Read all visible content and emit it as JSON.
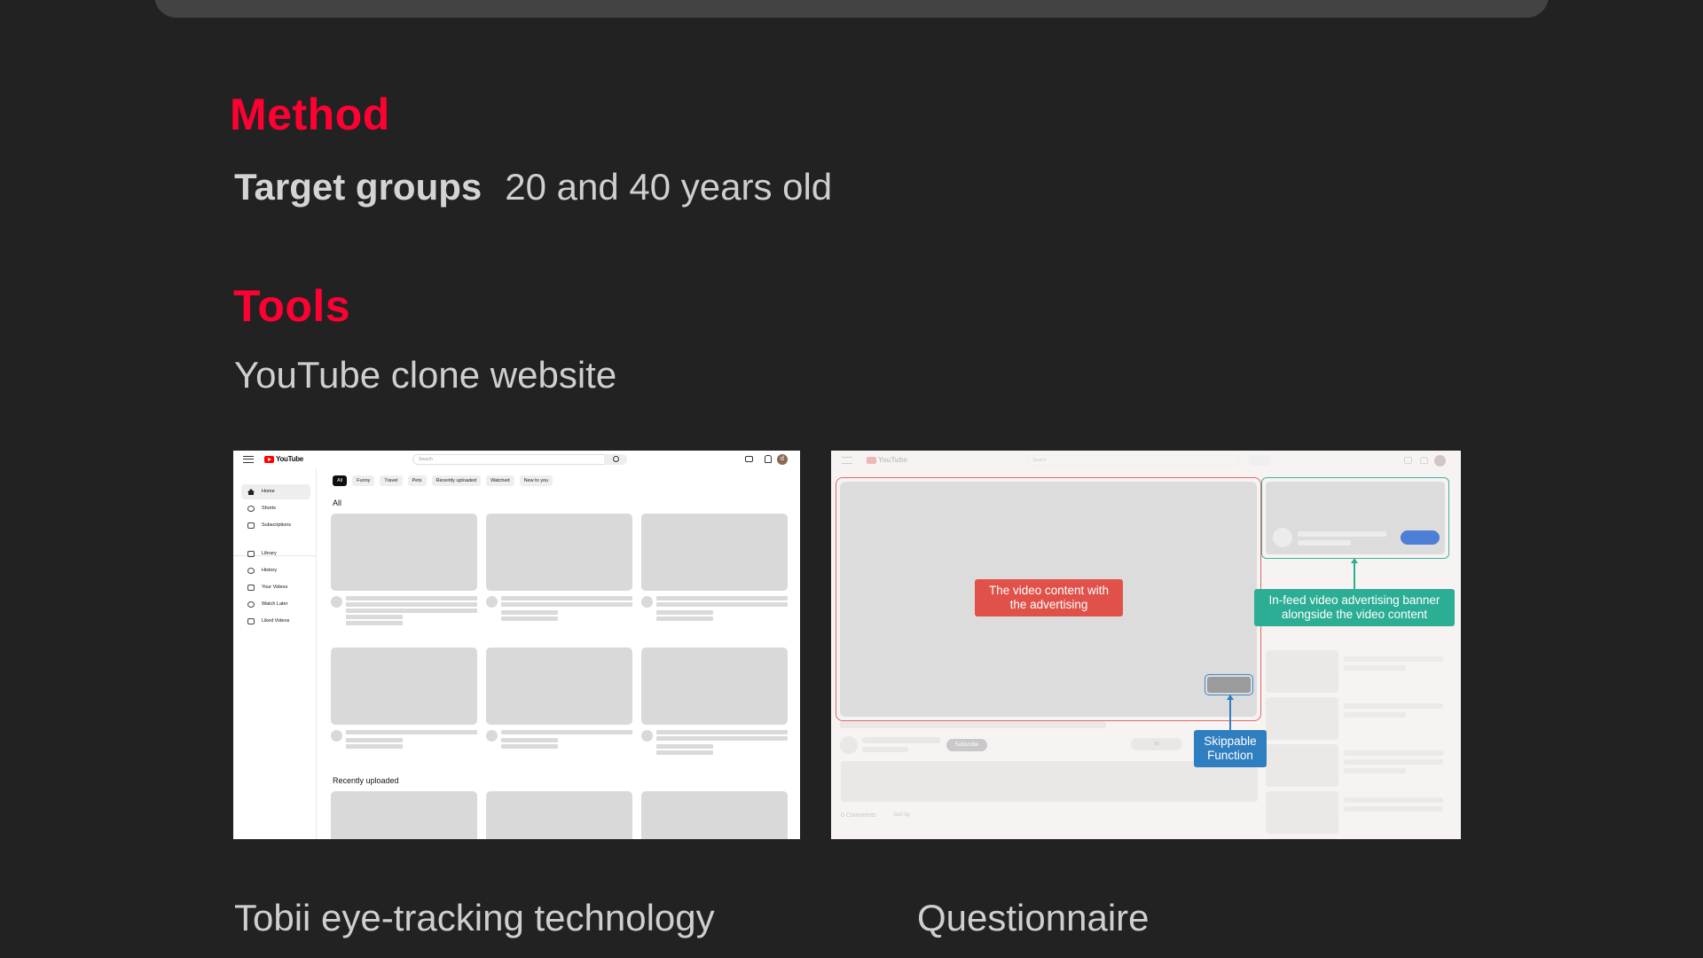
{
  "method": {
    "title": "Method",
    "target_label": "Target groups",
    "target_value": "20 and 40 years old"
  },
  "tools": {
    "title": "Tools",
    "description": "YouTube clone website"
  },
  "footer": {
    "left": "Tobii eye-tracking technology",
    "right": "Questionnaire"
  },
  "colors": {
    "accent": "#ff0033",
    "background": "#222222",
    "callout_red": "#e0514a",
    "callout_green": "#2cae95",
    "callout_blue": "#2f7ec0"
  },
  "screenshot_home": {
    "logo": "YouTube",
    "search_placeholder": "Search",
    "avatar_letter": "d",
    "sidebar": [
      {
        "label": "Home",
        "icon": "home-icon"
      },
      {
        "label": "Shorts",
        "icon": "shorts-icon"
      },
      {
        "label": "Subscriptions",
        "icon": "subscriptions-icon"
      },
      {
        "label": "Library",
        "icon": "library-icon"
      },
      {
        "label": "History",
        "icon": "history-icon"
      },
      {
        "label": "Your Videos",
        "icon": "your-videos-icon"
      },
      {
        "label": "Watch Later",
        "icon": "watch-later-icon"
      },
      {
        "label": "Liked Videos",
        "icon": "liked-videos-icon"
      }
    ],
    "chips": [
      "All",
      "Funny",
      "Travel",
      "Pets",
      "Recently uploaded",
      "Watched",
      "New to you"
    ],
    "section_all": "All",
    "section_recent": "Recently uploaded"
  },
  "screenshot_watch": {
    "logo": "YouTube",
    "search_placeholder": "Search",
    "subscribe": "Subscribe",
    "likes": "0k",
    "comments": "0 Comments",
    "sort": "Sort by",
    "callout_video": "The video content with the advertising",
    "callout_infeed": "In-feed video advertising banner alongside the video content",
    "callout_skip": "Skippable Function"
  }
}
